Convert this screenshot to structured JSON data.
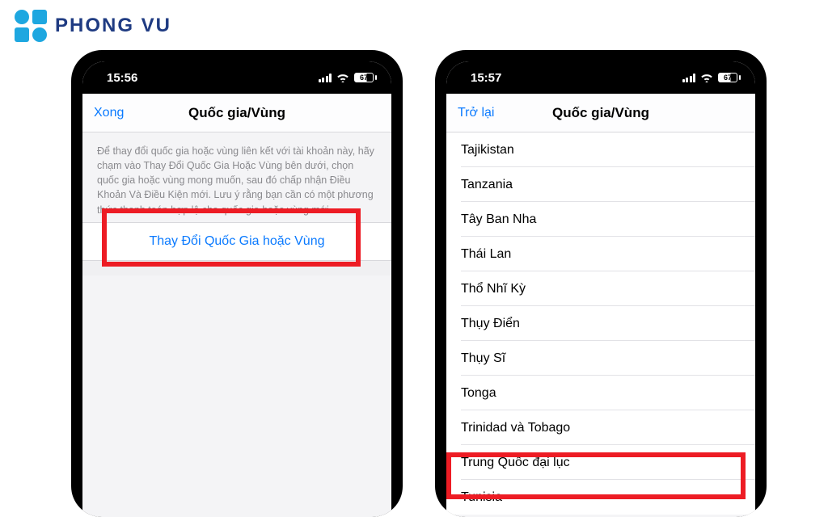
{
  "brand": {
    "name": "PHONG VU"
  },
  "left_phone": {
    "status": {
      "time": "15:56",
      "battery": "67"
    },
    "nav": {
      "back": "Xong",
      "title": "Quốc gia/Vùng"
    },
    "help_text": "Để thay đổi quốc gia hoặc vùng liên kết với tài khoản này, hãy chạm vào Thay Đổi Quốc Gia Hoặc Vùng bên dưới, chọn quốc gia hoặc vùng mong muốn, sau đó chấp nhận Điều Khoản Và Điều Kiện mới. Lưu ý rằng bạn cần có một phương thức thanh toán hợp lệ cho quốc gia hoặc vùng mới.",
    "action": "Thay Đổi Quốc Gia hoặc Vùng"
  },
  "right_phone": {
    "status": {
      "time": "15:57",
      "battery": "67"
    },
    "nav": {
      "back": "Trở lại",
      "title": "Quốc gia/Vùng"
    },
    "countries": [
      "Tajikistan",
      "Tanzania",
      "Tây Ban Nha",
      "Thái Lan",
      "Thổ Nhĩ Kỳ",
      "Thụy Điển",
      "Thụy Sĩ",
      "Tonga",
      "Trinidad và Tobago",
      "Trung Quốc đại lục",
      "Tunisia"
    ]
  },
  "colors": {
    "accent": "#0a7aff",
    "highlight": "#ed1c24",
    "brand": "#1f3b82"
  }
}
